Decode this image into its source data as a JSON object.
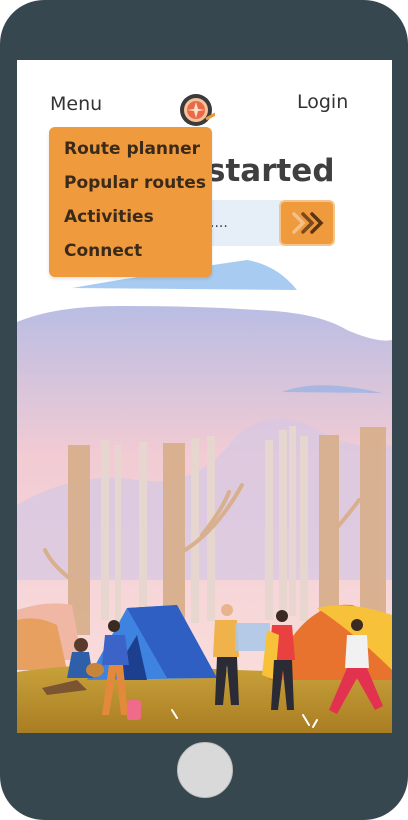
{
  "header": {
    "menu_label": "Menu",
    "login_label": "Login",
    "logo_icon": "compass-logo-icon"
  },
  "dropdown": {
    "items": [
      "Route planner",
      "Popular routes",
      "Activities",
      "Connect"
    ]
  },
  "hero": {
    "heading": "started"
  },
  "search": {
    "placeholder": "....",
    "button_icon": "double-chevron-right-icon"
  },
  "colors": {
    "accent": "#ef9a3c",
    "phone_frame": "#37474f",
    "search_bg": "#e6eef8"
  }
}
